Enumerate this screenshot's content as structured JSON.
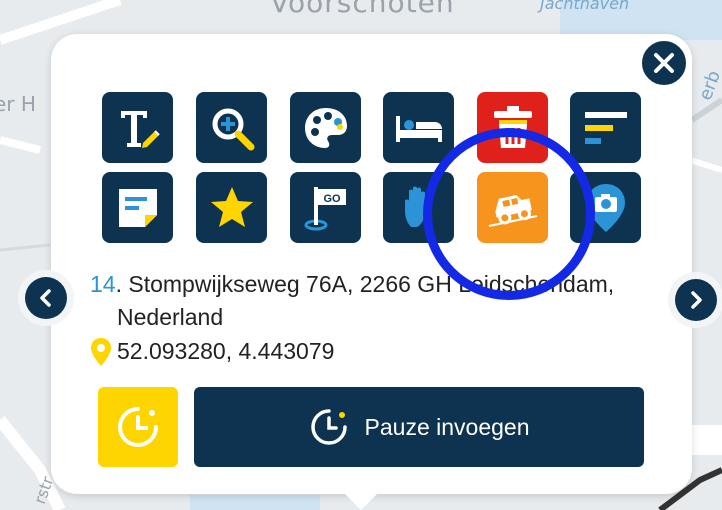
{
  "map": {
    "labels": [
      {
        "id": "voorschoten",
        "text": "Voorschoten"
      },
      {
        "id": "jachthaven",
        "text": "Jachthaven"
      },
      {
        "id": "left-edge",
        "text": "er H"
      },
      {
        "id": "right-edge",
        "text": "erb"
      },
      {
        "id": "bottom-edge",
        "text": "rstr"
      }
    ]
  },
  "popup": {
    "tools": [
      {
        "name": "edit-text",
        "icon": "text-pencil-icon"
      },
      {
        "name": "search-zoom",
        "icon": "magnifier-plus-icon"
      },
      {
        "name": "palette",
        "icon": "palette-icon"
      },
      {
        "name": "overnight",
        "icon": "bed-icon"
      },
      {
        "name": "delete",
        "icon": "trash-icon",
        "color": "#e0211b"
      },
      {
        "name": "list",
        "icon": "bars-icon"
      },
      {
        "name": "note",
        "icon": "note-icon"
      },
      {
        "name": "favorite",
        "icon": "star-icon"
      },
      {
        "name": "start-flag",
        "icon": "go-flag-icon",
        "text": "GO"
      },
      {
        "name": "stop",
        "icon": "hand-icon"
      },
      {
        "name": "offroad",
        "icon": "offroad-vehicle-icon",
        "color": "#f7941d"
      },
      {
        "name": "photo-location",
        "icon": "camera-pin-icon"
      }
    ],
    "address": {
      "number": "14",
      "line1": ". Stompwijkseweg 76A, 2266 GH Leidschendam,",
      "line2": "Nederland",
      "coordinates": "52.093280, 4.443079"
    },
    "pause_button": {
      "label": "Pauze invoegen"
    },
    "colors": {
      "navy": "#0d3350",
      "yellow": "#ffd500",
      "red": "#e0211b",
      "orange": "#f7941d",
      "accent_blue": "#2b93d6",
      "ring_blue": "#1429e6"
    }
  }
}
